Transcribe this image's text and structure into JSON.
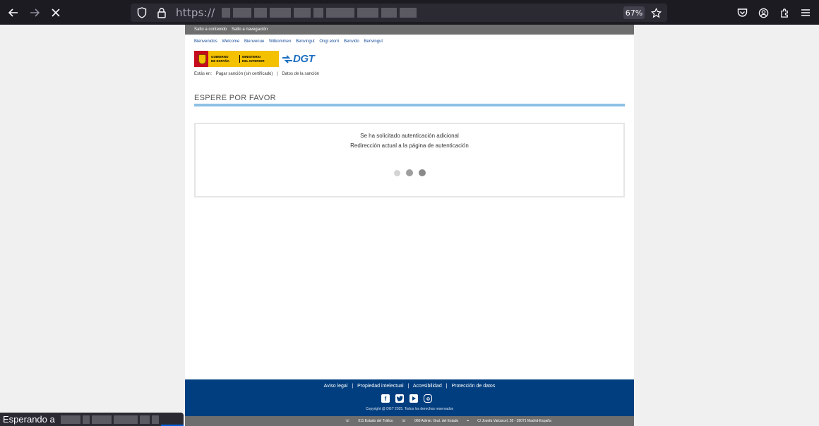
{
  "browser": {
    "url_prefix": "https://",
    "zoom": "67%",
    "status_text": "Esperando a"
  },
  "page": {
    "skip_links": [
      "Salto a contenido",
      "Salto a navegación"
    ],
    "languages": [
      "Bienvenidos",
      "Welcome",
      "Bienvenue",
      "Wilkommen",
      "Benvingut",
      "Ongi etorri",
      "Benvido",
      "Benvingut"
    ],
    "logo": {
      "gob_line1": "GOBIERNO",
      "gob_line2": "DE ESPAÑA",
      "ministry_line1": "MINISTERIO",
      "ministry_line2": "DEL INTERIOR",
      "dgt": "DGT"
    },
    "breadcrumb": {
      "label": "Estás en:",
      "item1": "Pagar sanción (sin certificado)",
      "sep": "|",
      "item2": "Datos de la sanción"
    },
    "title": "ESPERE POR FAVOR",
    "message_line1": "Se ha solicitado autenticación adicional",
    "message_line2": "Redirección actual a la página de autenticación"
  },
  "footer": {
    "links": [
      "Aviso legal",
      "Propiedad intelectual",
      "Accesibilidad",
      "Protección de datos"
    ],
    "separator": "|",
    "social": [
      "facebook-icon",
      "twitter-icon",
      "youtube-icon",
      "instagram-icon"
    ],
    "copyright": "Copyright @ DGT 2025. Todos los derechos reservados",
    "contacts": [
      "011 Estado del Tráfico",
      "060 Admin. Gral. del Estado",
      "C/ Josefa Valcárcel, 28 - 28071 Madrid-España"
    ]
  },
  "colors": {
    "footer_blue": "#003e7f",
    "title_rule": "#8ec0e6",
    "gob_yellow": "#f3c100"
  }
}
